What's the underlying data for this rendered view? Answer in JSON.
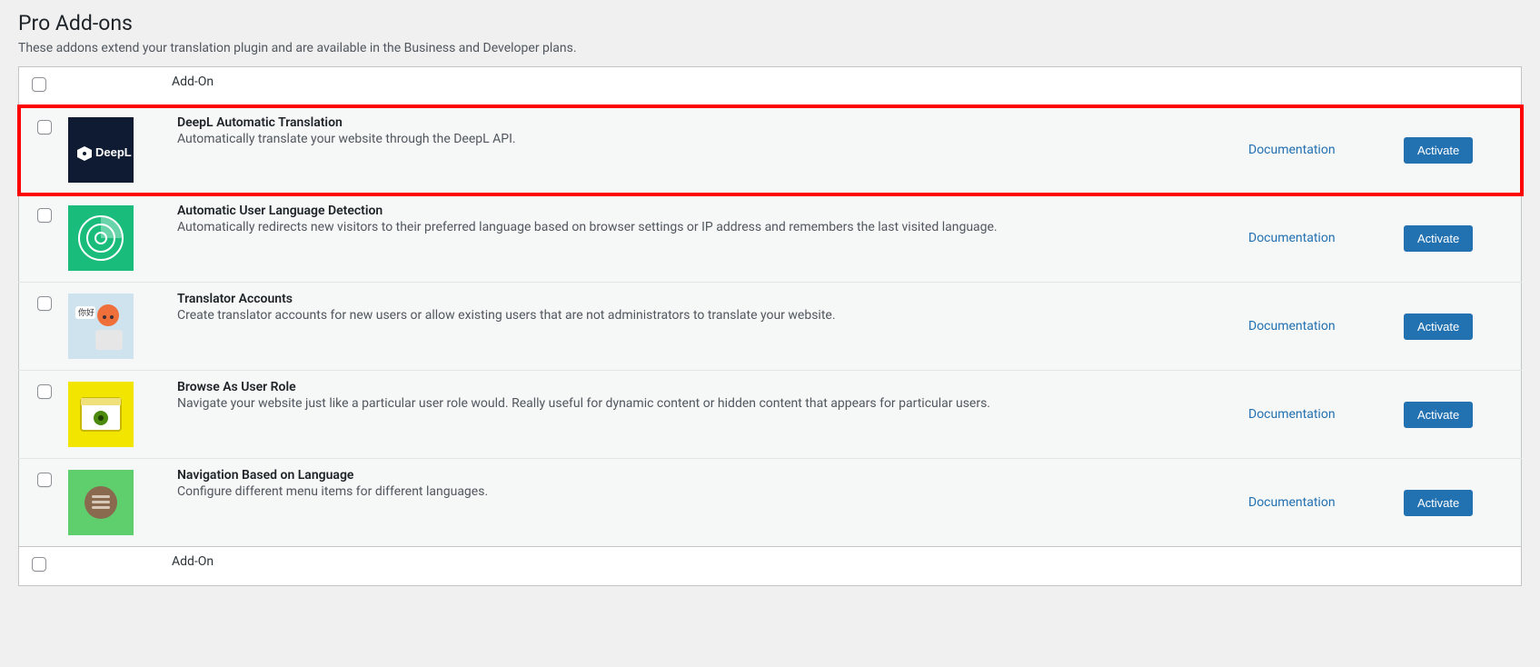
{
  "section": {
    "title": "Pro Add-ons",
    "description": "These addons extend your translation plugin and are available in the Business and Developer plans."
  },
  "table": {
    "header_addon": "Add-On",
    "footer_addon": "Add-On",
    "doc_label": "Documentation",
    "activate_label": "Activate"
  },
  "addons": [
    {
      "title": "DeepL Automatic Translation",
      "description": "Automatically translate your website through the DeepL API.",
      "icon_name": "deepl-icon",
      "icon_bg": "#0e1b33",
      "highlighted": true
    },
    {
      "title": "Automatic User Language Detection",
      "description": "Automatically redirects new visitors to their preferred language based on browser settings or IP address and remembers the last visited language.",
      "icon_name": "radar-icon",
      "icon_bg": "#1abc7b",
      "highlighted": false
    },
    {
      "title": "Translator Accounts",
      "description": "Create translator accounts for new users or allow existing users that are not administrators to translate your website.",
      "icon_name": "translator-person-icon",
      "icon_bg": "#cfe3ee",
      "highlighted": false
    },
    {
      "title": "Browse As User Role",
      "description": "Navigate your website just like a particular user role would. Really useful for dynamic content or hidden content that appears for particular users.",
      "icon_name": "eye-icon",
      "icon_bg": "#f2e600",
      "highlighted": false
    },
    {
      "title": "Navigation Based on Language",
      "description": "Configure different menu items for different languages.",
      "icon_name": "menu-icon",
      "icon_bg": "#5fcf6e",
      "highlighted": false
    }
  ]
}
